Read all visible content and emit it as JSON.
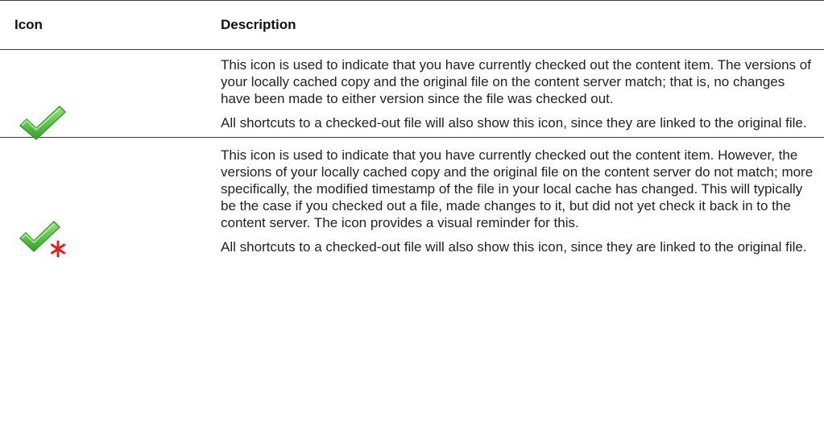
{
  "table": {
    "headers": {
      "icon": "Icon",
      "description": "Description"
    },
    "rows": [
      {
        "icon": "checkmark-icon",
        "paragraphs": [
          "This icon is used to indicate that you have currently checked out the content item. The versions of your locally cached copy and the original file on the content server match; that is, no changes have been made to either version since the file was checked out.",
          "All shortcuts to a checked-out file will also show this icon, since they are linked to the original file."
        ]
      },
      {
        "icon": "checkmark-modified-icon",
        "paragraphs": [
          "This icon is used to indicate that you have currently checked out the content item. However, the versions of your locally cached copy and the original file on the content server do not match; more specifically, the modified timestamp of the file in your local cache has changed. This will typically be the case if you checked out a file, made changes to it, but did not yet check it back in to the content server. The icon provides a visual reminder for this.",
          "All shortcuts to a checked-out file will also show this icon, since they are linked to the original file."
        ]
      }
    ]
  },
  "colors": {
    "check_green": "#5cc24a",
    "check_dark": "#3d9a2e",
    "asterisk_red": "#e02020",
    "rule": "#3a3a3a"
  }
}
